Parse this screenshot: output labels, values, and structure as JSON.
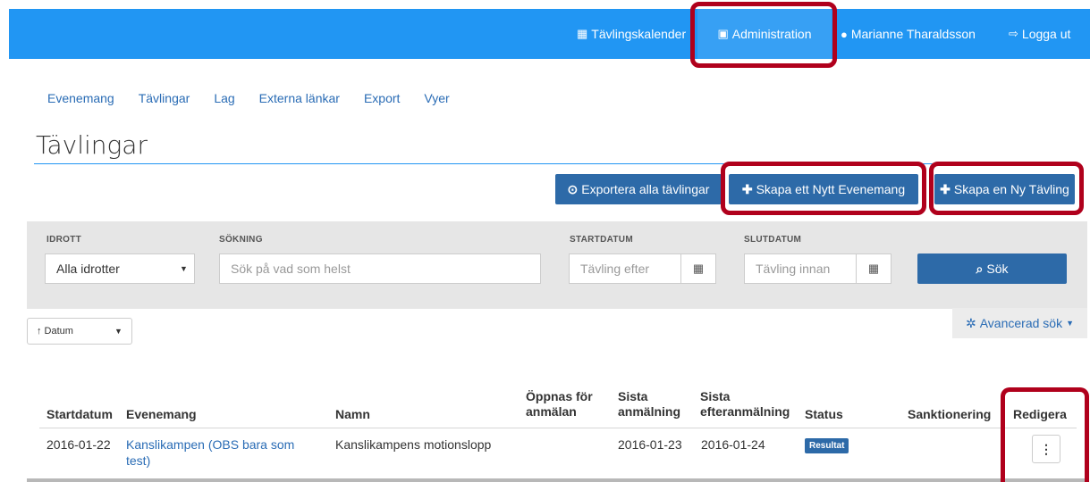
{
  "topbar": {
    "items": [
      {
        "label": "Tävlingskalender",
        "icon": "calendar-icon"
      },
      {
        "label": "Administration",
        "icon": "briefcase-icon"
      },
      {
        "label": "Marianne Tharaldsson",
        "icon": "user-icon"
      },
      {
        "label": "Logga ut",
        "icon": "logout-icon"
      }
    ],
    "color": "#2196f3"
  },
  "subnav": [
    "Evenemang",
    "Tävlingar",
    "Lag",
    "Externa länkar",
    "Export",
    "Vyer"
  ],
  "page_title": "Tävlingar",
  "actions": {
    "export_all": "Exportera alla tävlingar",
    "new_event": "Skapa ett Nytt Evenemang",
    "new_competition": "Skapa en Ny Tävling"
  },
  "filters": {
    "sport": {
      "label": "IDROTT",
      "value": "Alla idrotter"
    },
    "search": {
      "label": "SÖKNING",
      "placeholder": "Sök på vad som helst"
    },
    "start": {
      "label": "STARTDATUM",
      "placeholder": "Tävling efter"
    },
    "end": {
      "label": "SLUTDATUM",
      "placeholder": "Tävling innan"
    },
    "search_button": "Sök"
  },
  "advanced_search": "Avancerad sök",
  "sort": {
    "value": "↑ Datum"
  },
  "table": {
    "headers": {
      "start": "Startdatum",
      "event": "Evenemang",
      "name": "Namn",
      "opens_1": "Öppnas för",
      "opens_2": "anmälan",
      "last_1": "Sista",
      "last_2": "anmälning",
      "late_1": "Sista",
      "late_2": "efteranmälning",
      "status": "Status",
      "sanction": "Sanktionering",
      "edit": "Redigera"
    },
    "rows": [
      {
        "start": "2016-01-22",
        "event_1": "Kanslikampen (OBS bara som",
        "event_2": "test)",
        "name": "Kanslikampens motionslopp",
        "opens": "",
        "last": "2016-01-23",
        "late": "2016-01-24",
        "status": "Resultat",
        "sanction": ""
      }
    ]
  },
  "accent_colors": {
    "primary": "#2d6aa8",
    "highlight": "#b0001c"
  }
}
